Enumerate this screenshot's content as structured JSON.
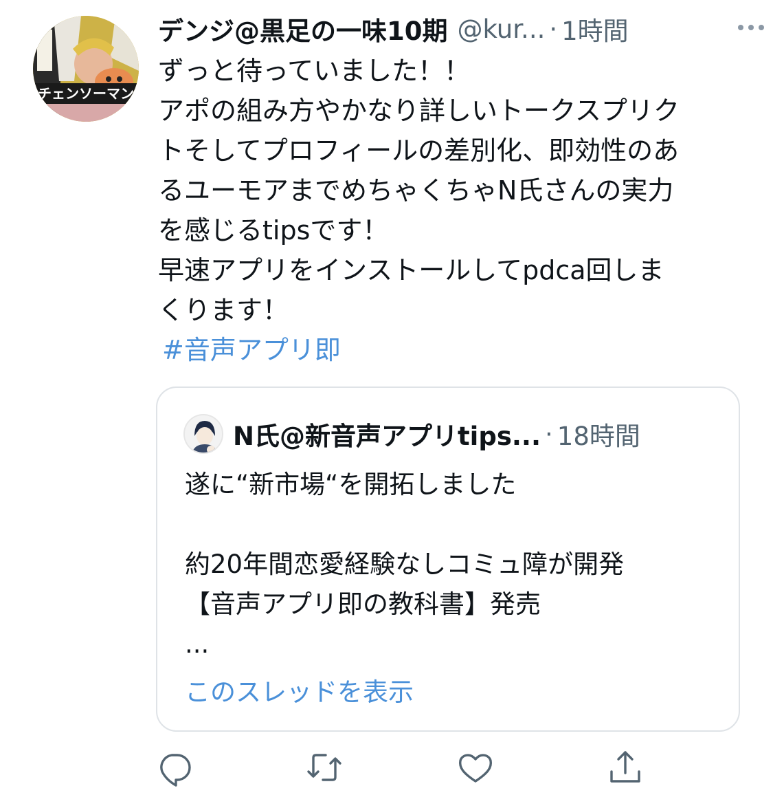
{
  "author": {
    "display_name": "デンジ@黒足の一味10期",
    "handle": "@kur...",
    "separator": "·",
    "time": "1時間",
    "avatar_text": "チェンソーマン"
  },
  "tweet": {
    "lines": [
      "ずっと待っていました！！",
      "アポの組み方やかなり詳しいトークスプリク",
      "トそしてプロフィールの差別化、即効性のあ",
      "るユーモアまでめちゃくちゃN氏さんの実力",
      "を感じるtipsです！",
      "早速アプリをインストールしてpdca回しま",
      "くります！"
    ],
    "hashtag": "#音声アプリ即"
  },
  "quote": {
    "display_name": "N氏@新音声アプリtips...",
    "separator": "·",
    "time": "18時間",
    "lines": [
      "遂に“新市場“を開拓しました",
      "",
      "約20年間恋愛経験なしコミュ障が開発",
      "【音声アプリ即の教科書】発売",
      "..."
    ],
    "thread_link": "このスレッドを表示"
  },
  "colors": {
    "text": "#0f1419",
    "secondary": "#536471",
    "link": "#4a90d9",
    "border": "#dfe3e7",
    "icon": "#536471"
  },
  "icons": [
    "more-icon",
    "reply-icon",
    "retweet-icon",
    "like-icon",
    "share-icon"
  ]
}
